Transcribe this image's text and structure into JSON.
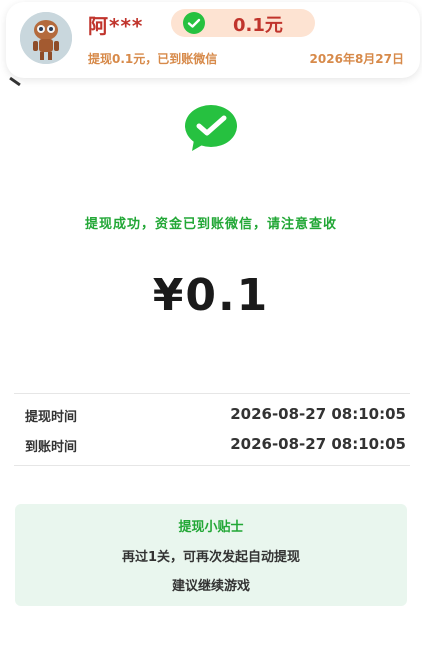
{
  "notification": {
    "name": "阿***",
    "amount": "0.1元",
    "description": "提现0.1元，已到账微信",
    "date": "2026年8月27日"
  },
  "success": {
    "message": "提现成功，资金已到账微信，请注意查收",
    "amount": "¥0.1"
  },
  "details": [
    {
      "label": "提现时间",
      "value": "2026-08-27 08:10:05"
    },
    {
      "label": "到账时间",
      "value": "2026-08-27 08:10:05"
    }
  ],
  "tips": {
    "title": "提现小贴士",
    "line1": "再过1关，可再次发起自动提现",
    "line2": "建议继续游戏"
  },
  "colors": {
    "accent_green": "#22a736",
    "wechat_green": "#26c140",
    "name_red": "#c0342c",
    "desc_orange": "#d78a4a",
    "tips_bg": "#e9f6ee"
  }
}
